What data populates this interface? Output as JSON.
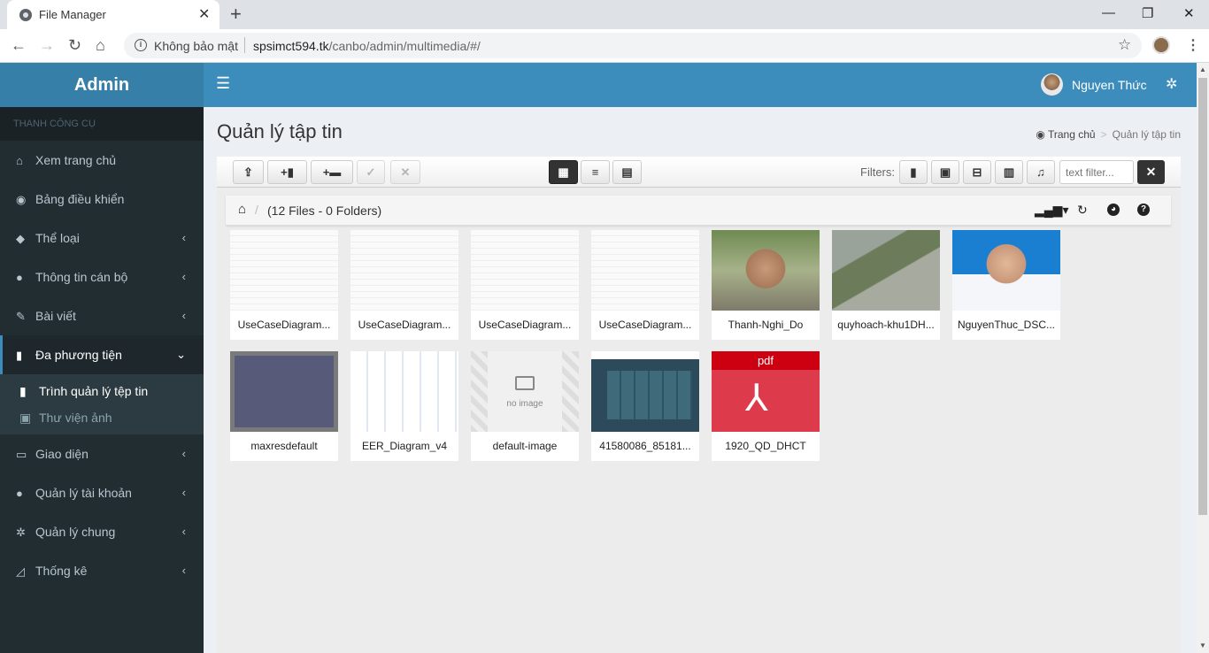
{
  "browser": {
    "tab_title": "File Manager",
    "security_label": "Không bảo mật",
    "url_host": "spsimct594.tk",
    "url_path": "/canbo/admin/multimedia/#/"
  },
  "sidebar": {
    "brand": "Admin",
    "section_header": "THANH CÔNG CỤ",
    "items": [
      {
        "label": "Xem trang chủ",
        "icon": "home-icon"
      },
      {
        "label": "Bảng điều khiển",
        "icon": "dashboard-icon"
      },
      {
        "label": "Thể loại",
        "icon": "tag-icon"
      },
      {
        "label": "Thông tin cán bộ",
        "icon": "user-icon"
      },
      {
        "label": "Bài viết",
        "icon": "edit-icon"
      },
      {
        "label": "Đa phương tiện",
        "icon": "file-icon"
      },
      {
        "label": "Giao diện",
        "icon": "desktop-icon"
      },
      {
        "label": "Quản lý tài khoản",
        "icon": "users-icon"
      },
      {
        "label": "Quản lý chung",
        "icon": "cogs-icon"
      },
      {
        "label": "Thống kê",
        "icon": "chart-icon"
      }
    ],
    "submenu": [
      {
        "label": "Trình quản lý tệp tin",
        "icon": "file-icon"
      },
      {
        "label": "Thư viện ảnh",
        "icon": "image-icon"
      }
    ]
  },
  "header": {
    "user_name": "Nguyen Thức"
  },
  "page": {
    "title": "Quản lý tập tin",
    "breadcrumb": {
      "home": "Trang chủ",
      "current": "Quản lý tập tin"
    }
  },
  "toolbar": {
    "filters_label": "Filters:",
    "filter_placeholder": "text filter..."
  },
  "pathbar": {
    "count_label": "(12 Files - 0 Folders)"
  },
  "files": [
    {
      "name": "UseCaseDiagram..."
    },
    {
      "name": "UseCaseDiagram..."
    },
    {
      "name": "UseCaseDiagram..."
    },
    {
      "name": "UseCaseDiagram..."
    },
    {
      "name": "Thanh-Nghi_Do"
    },
    {
      "name": "quyhoach-khu1DH..."
    },
    {
      "name": "NguyenThuc_DSC..."
    },
    {
      "name": "maxresdefault"
    },
    {
      "name": "EER_Diagram_v4"
    },
    {
      "name": "default-image",
      "placeholder_text": "no image"
    },
    {
      "name": "41580086_85181..."
    },
    {
      "name": "1920_QD_DHCT",
      "badge": "pdf"
    }
  ],
  "colors": {
    "header": "#3c8dbc",
    "brand": "#367fa9",
    "sidebar": "#222d32",
    "pdf": "#dd3b4c"
  }
}
